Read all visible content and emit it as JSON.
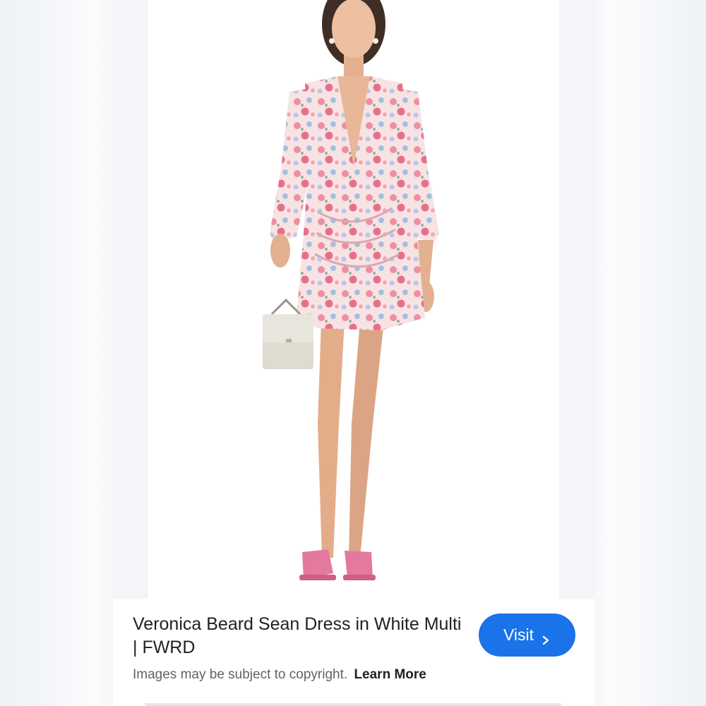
{
  "product": {
    "title": "Veronica Beard Sean Dress in White Multi | FWRD",
    "image_alt": "Model wearing floral print mini dress"
  },
  "actions": {
    "visit_label": "Visit",
    "visit_icon": "chevron-right-icon"
  },
  "footnote": {
    "copyright_text": "Images may be subject to copyright.",
    "learn_more_label": "Learn More"
  },
  "colors": {
    "accent": "#1a73e8",
    "title_text": "#202124",
    "secondary_text": "#5f6368"
  }
}
